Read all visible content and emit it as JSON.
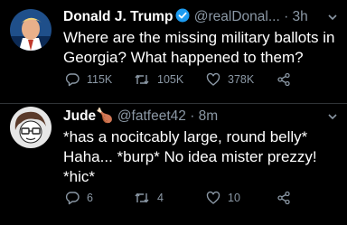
{
  "tweets": [
    {
      "author": "Donald J. Trump",
      "handle": "@realDonal...",
      "dot": "·",
      "time": "3h",
      "verified": true,
      "text": "Where are the missing military ballots in Georgia? What happened to them?",
      "replies": "115K",
      "retweets": "105K",
      "likes": "378K"
    },
    {
      "author": "Jude",
      "author_emoji": "🍗",
      "handle": "@fatfeet42",
      "dot": "·",
      "time": "8m",
      "text": "*has a nocitcably large, round belly* Haha... *burp* No idea mister prezzy! *hic*",
      "replies": "6",
      "retweets": "4",
      "likes": "10"
    }
  ],
  "colors": {
    "background": "#000000",
    "secondary_text": "#8b98a5",
    "verified": "#1d9bf0",
    "divider": "#2f3336"
  },
  "icons": [
    "reply-icon",
    "retweet-icon",
    "like-icon",
    "share-icon",
    "chevron-down-icon",
    "verified-icon"
  ]
}
